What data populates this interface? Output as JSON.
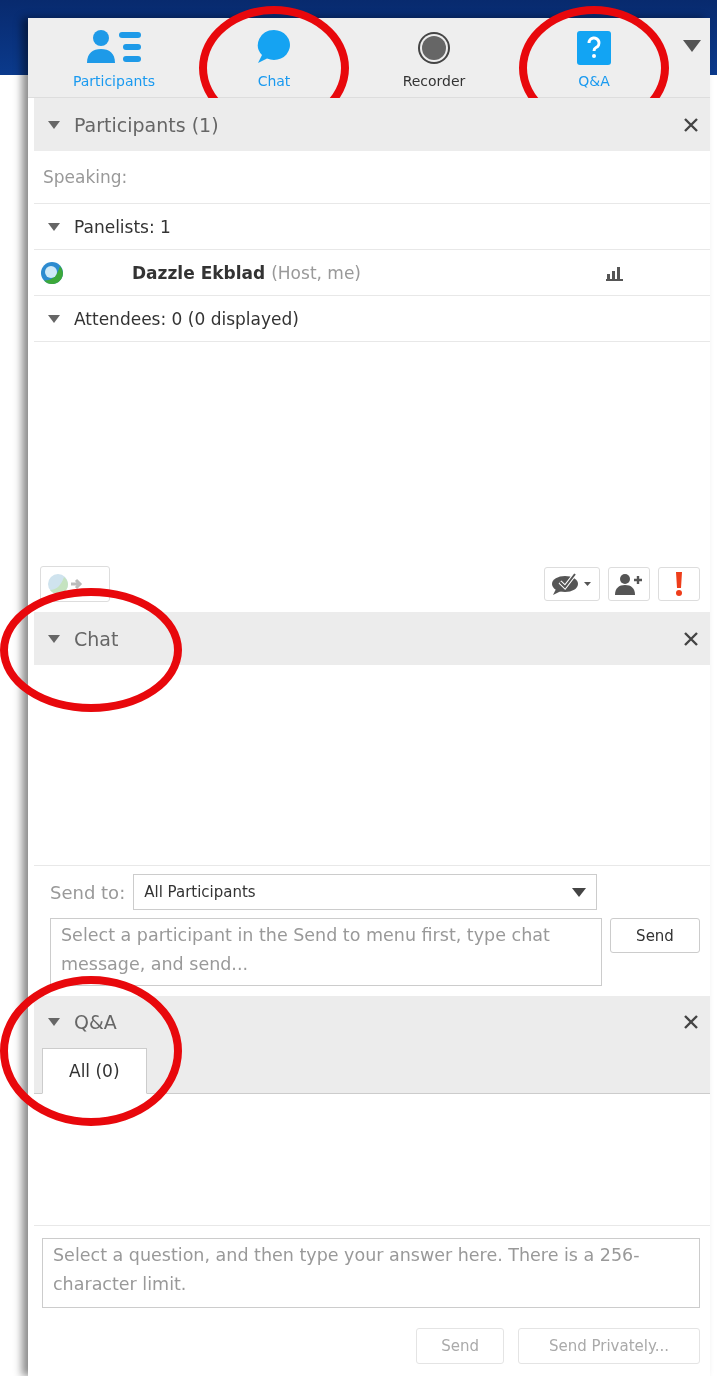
{
  "tabs": [
    {
      "label": "Participants",
      "kind": "participants",
      "open": true,
      "circled": false
    },
    {
      "label": "Chat",
      "kind": "chat",
      "open": true,
      "circled": true
    },
    {
      "label": "Recorder",
      "kind": "recorder",
      "open": false,
      "circled": false
    },
    {
      "label": "Q&A",
      "kind": "qa",
      "open": true,
      "circled": true
    }
  ],
  "participants": {
    "title": "Participants (1)",
    "expanded": true,
    "speaking": "Speaking:",
    "groups": [
      {
        "label": "Panelists: 1",
        "expanded": true,
        "children": [
          {
            "name": "Dazzle Ekblad",
            "role": "(Host, me)"
          }
        ]
      },
      {
        "label": "Attendees: 0 (0 displayed)",
        "expanded": true
      }
    ]
  },
  "chat": {
    "title": "Chat",
    "circled": true,
    "expanded": true,
    "send_to_label": "Send to:",
    "send_to_value": "All Participants",
    "placeholder": "Select a participant in the Send to menu first, type chat message, and send...",
    "send": "Send"
  },
  "qa": {
    "title": "Q&A",
    "circled": true,
    "expanded": true,
    "tabs": [
      {
        "label": "All (0)",
        "selected": true
      }
    ],
    "placeholder": "Select a question, and then type your answer here. There is a 256-character limit.",
    "buttons": [
      {
        "label": "Send",
        "disabled": true
      },
      {
        "label": "Send Privately...",
        "disabled": true
      }
    ]
  }
}
